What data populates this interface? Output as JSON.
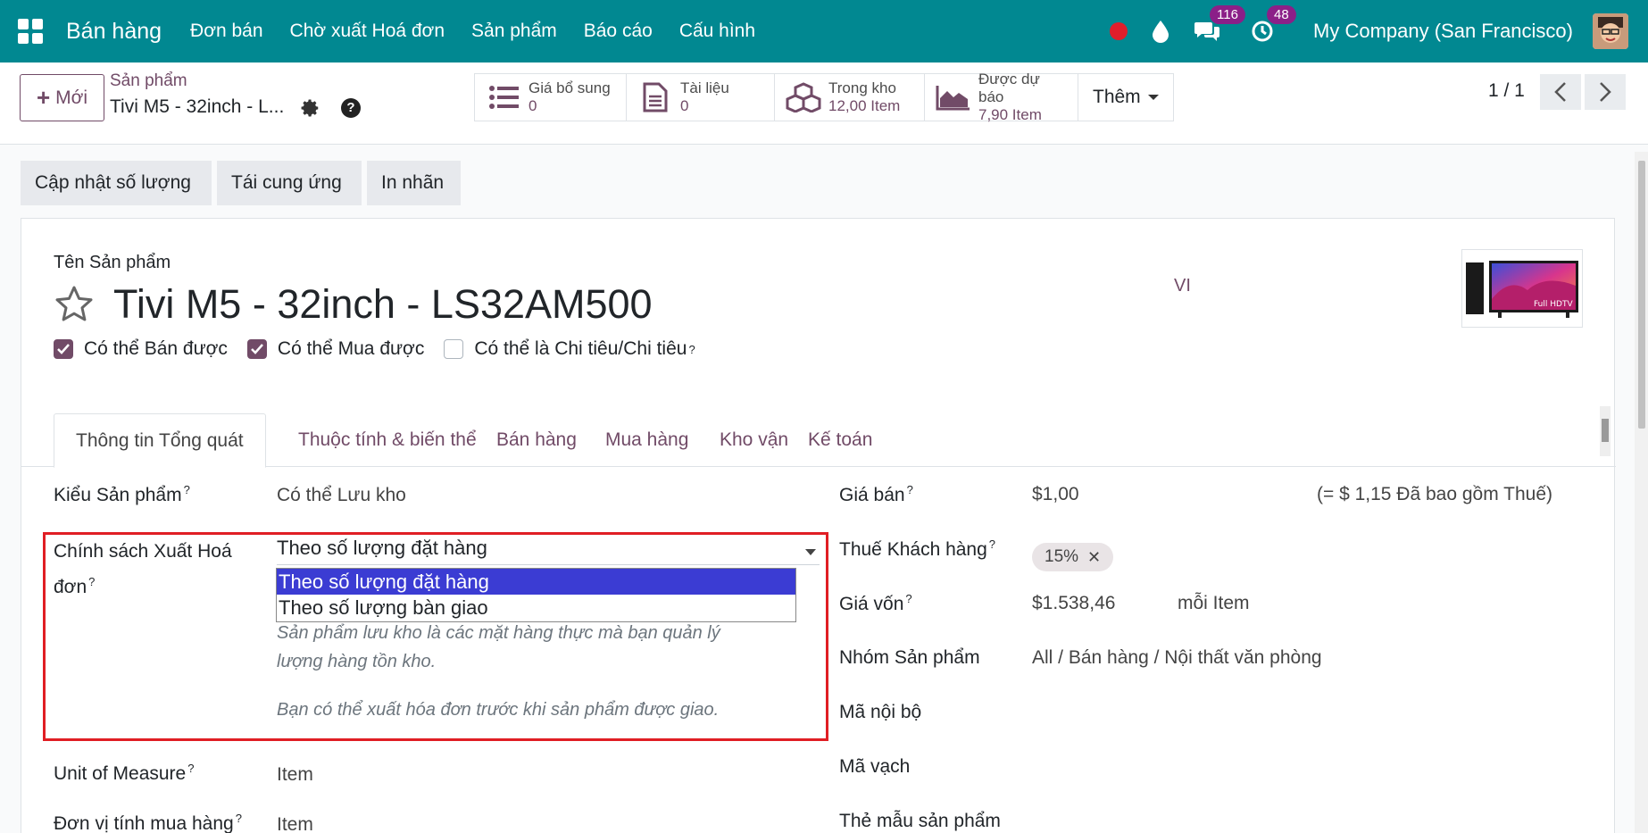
{
  "topbar": {
    "app_name": "Bán hàng",
    "menu": [
      "Đơn bán",
      "Chờ xuất Hoá đơn",
      "Sản phẩm",
      "Báo cáo",
      "Cấu hình"
    ],
    "messages_count": "116",
    "activities_count": "48",
    "company": "My Company (San Francisco)"
  },
  "control_panel": {
    "new_button": "Mới",
    "breadcrumb_parent": "Sản phẩm",
    "breadcrumb_current": "Tivi M5 - 32inch - L...",
    "smart_buttons": [
      {
        "label": "Giá bổ sung",
        "value": "0"
      },
      {
        "label": "Tài liệu",
        "value": "0"
      },
      {
        "label": "Trong kho",
        "value": "12,00 Item"
      },
      {
        "label": "Được dự báo",
        "value": "7,90 Item"
      }
    ],
    "more_button": "Thêm",
    "pager": "1 / 1"
  },
  "status_buttons": [
    "Cập nhật số lượng",
    "Tái cung ứng",
    "In nhãn"
  ],
  "form": {
    "name_label": "Tên Sản phẩm",
    "product_name": "Tivi M5 - 32inch - LS32AM500",
    "lang": "VI",
    "image_text": "Full HDTV",
    "checkboxes": [
      {
        "label": "Có thể Bán được",
        "checked": true
      },
      {
        "label": "Có thể Mua được",
        "checked": true
      },
      {
        "label": "Có thể là Chi tiêu/Chi tiêu",
        "checked": false
      }
    ],
    "tabs": [
      "Thông tin Tổng quát",
      "Thuộc tính & biến thể",
      "Bán hàng",
      "Mua hàng",
      "Kho vận",
      "Kế toán"
    ],
    "left_fields": {
      "product_type_label": "Kiểu Sản phẩm",
      "product_type_value": "Có thể Lưu kho",
      "invoice_policy_label_1": "Chính sách Xuất Hoá",
      "invoice_policy_label_2": "đơn",
      "invoice_policy_value": "Theo số lượng đặt hàng",
      "invoice_policy_options": [
        "Theo số lượng đặt hàng",
        "Theo số lượng bàn giao"
      ],
      "hint_1a": "Sản phẩm lưu kho là các mặt hàng thực mà bạn quản lý",
      "hint_1b": "lượng hàng tồn kho.",
      "hint_2": "Bạn có thể xuất hóa đơn trước khi sản phẩm được giao.",
      "uom_label": "Unit of Measure",
      "uom_value": "Item",
      "purchase_uom_label": "Đơn vị tính mua hàng",
      "purchase_uom_value": "Item"
    },
    "right_fields": {
      "sale_price_label": "Giá bán",
      "sale_price_value": "$1,00",
      "sale_price_tax_note": "(= $ 1,15 Đã bao gồm Thuế)",
      "customer_tax_label": "Thuế Khách hàng",
      "customer_tax_value": "15%",
      "cost_label": "Giá vốn",
      "cost_value": "$1.538,46",
      "cost_unit": "mỗi Item",
      "category_label": "Nhóm Sản phẩm",
      "category_value": "All / Bán hàng / Nội thất văn phòng",
      "internal_ref_label": "Mã nội bộ",
      "barcode_label": "Mã vạch",
      "tags_label": "Thẻ mẫu sản phẩm"
    }
  },
  "colors": {
    "navbar": "#018891",
    "primary": "#714b67",
    "highlight_box": "#e01e24",
    "selected_option": "#3b3cd3"
  }
}
